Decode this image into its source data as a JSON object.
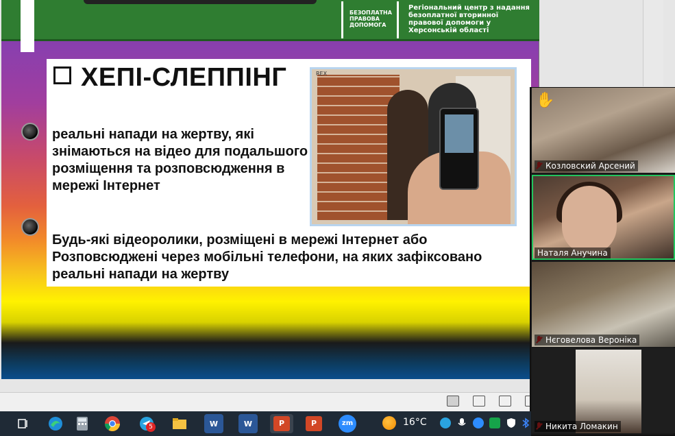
{
  "slide": {
    "logo_text": "БЕЗОПЛАТНА ПРАВОВА ДОПОМОГА",
    "org_text": "Регіональний центр з надання безоплатної вторинної правової допомоги у Херсонській області",
    "title": "ХЕПІ-СЛЕППІНГ",
    "paragraph_1": "реальні напади на жертву, які знімаються на відео для подальшого розміщення та розповсюдження в мережі Інтернет",
    "paragraph_2": "Будь-які відеоролики, розміщені в мережі Інтернет або Розповсюджені через мобільні телефони, на яких зафіксовано реальні напади на жертву",
    "photo_watermark": "REX"
  },
  "participants": [
    {
      "name": "Козловский Арсений",
      "muted": true,
      "hand_raised": true,
      "active_speaker": false
    },
    {
      "name": "Наталя Анучина",
      "muted": false,
      "hand_raised": false,
      "active_speaker": true
    },
    {
      "name": "Нєговелова Вероніка",
      "muted": true,
      "hand_raised": false,
      "active_speaker": false
    },
    {
      "name": "Никита Ломакин",
      "muted": true,
      "hand_raised": false,
      "active_speaker": false
    }
  ],
  "taskbar": {
    "apps": [
      {
        "icon": "task-view-icon",
        "label": ""
      },
      {
        "icon": "edge-icon",
        "label": ""
      },
      {
        "icon": "calculator-icon",
        "label": ""
      },
      {
        "icon": "chrome-icon",
        "label": ""
      },
      {
        "icon": "telegram-icon",
        "label": "",
        "badge": "5"
      },
      {
        "icon": "file-explorer-icon",
        "label": ""
      },
      {
        "icon": "word-icon",
        "label": "W"
      },
      {
        "icon": "word-icon",
        "label": "W"
      },
      {
        "icon": "powerpoint-icon",
        "label": "P"
      },
      {
        "icon": "powerpoint-icon",
        "label": "P"
      },
      {
        "icon": "zoom-icon",
        "label": "zm"
      }
    ],
    "weather": "16°C",
    "tray_badge": "5"
  },
  "colors": {
    "slide_header": "#2f7d31",
    "active_speaker_border": "#22c55e",
    "muted_icon": "#e02424",
    "taskbar": "#1f2a36"
  }
}
